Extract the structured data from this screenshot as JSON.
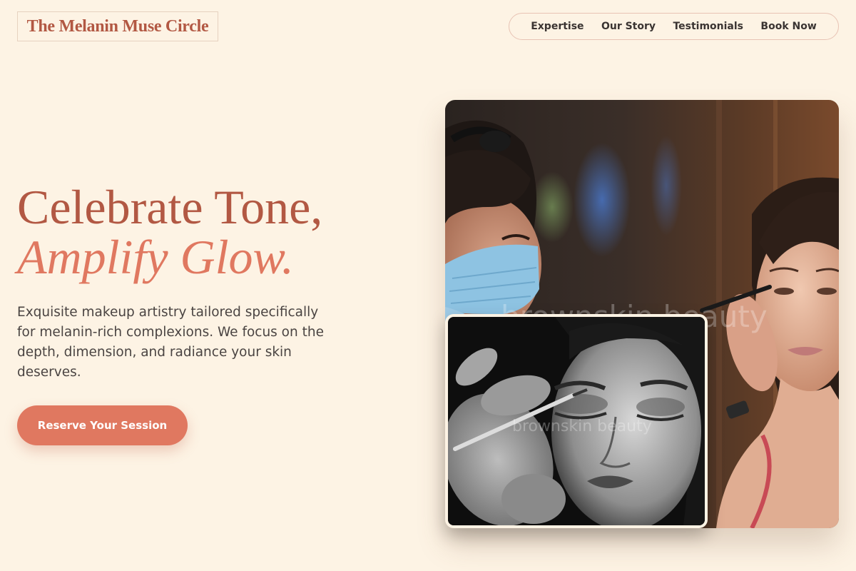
{
  "brand": {
    "name": "The Melanin Muse Circle"
  },
  "nav": {
    "items": [
      {
        "label": "Expertise"
      },
      {
        "label": "Our Story"
      },
      {
        "label": "Testimonials"
      },
      {
        "label": "Book Now"
      }
    ]
  },
  "hero": {
    "title_line1": "Celebrate Tone,",
    "title_line2": "Amplify Glow.",
    "description": "Exquisite makeup artistry tailored specifically for melanin-rich complexions. We focus on the depth, dimension, and radiance your skin deserves.",
    "cta_label": "Reserve Your Session"
  },
  "images": {
    "main": {
      "watermark": "brownskin beauty"
    },
    "inset": {
      "watermark": "brownskin beauty"
    }
  },
  "colors": {
    "background": "#fdf3e4",
    "brand": "#b25843",
    "accent": "#e07860",
    "text": "#4a4442"
  }
}
